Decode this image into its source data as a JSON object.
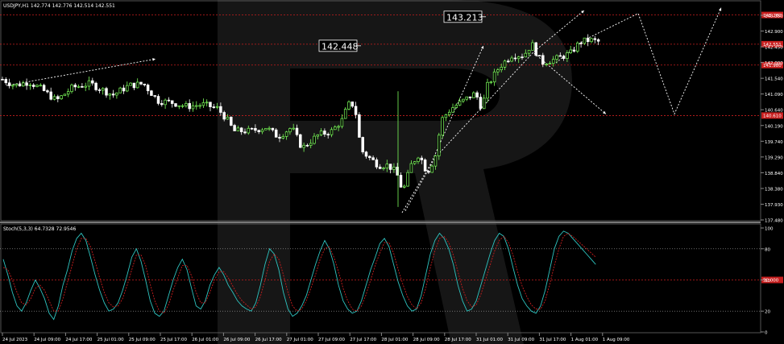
{
  "window": {
    "main_title": "USDJPY,H1  142.774 142.776 142.514 142.551",
    "osc_title": "Stoch(5,3,3) 64.7328 72.9546"
  },
  "colors": {
    "background": "#000000",
    "bull": "#7cfc5a",
    "bear": "#ffffff",
    "level": "#c81e1e",
    "level_tag": "#c81e1e",
    "forecast": "#ffffff",
    "stoch_main": "#2ec4c0",
    "stoch_signal": "#c81e1e",
    "axis_text": "#ffffff",
    "watermark": "#161616"
  },
  "chart_data": [
    {
      "type": "candlestick",
      "symbol": "USDJPY",
      "timeframe": "H1",
      "ylim": [
        137.88,
        143.4
      ],
      "y_ticks": [
        "143.350",
        "142.900",
        "142.450",
        "142.000",
        "141.540",
        "141.090",
        "140.640",
        "140.190",
        "139.740",
        "139.290",
        "138.840",
        "138.380",
        "137.930",
        "137.480"
      ],
      "x_ticks": [
        "24 Jul 2023",
        "24 Jul 09:00",
        "24 Jul 17:00",
        "25 Jul 01:00",
        "25 Jul 09:00",
        "25 Jul 17:00",
        "26 Jul 01:00",
        "26 Jul 09:00",
        "26 Jul 17:00",
        "27 Jul 01:00",
        "27 Jul 09:00",
        "27 Jul 17:00",
        "28 Jul 01:00",
        "28 Jul 09:00",
        "28 Jul 17:00",
        "31 Jul 01:00",
        "31 Jul 09:00",
        "31 Jul 17:00",
        "1 Aug 01:00",
        "1 Aug 09:00"
      ],
      "levels": [
        {
          "value": 143.26,
          "tag": "143.260"
        },
        {
          "value": 142.49,
          "tag": "142.551"
        },
        {
          "value": 141.94,
          "tag": "141.980"
        },
        {
          "value": 140.61,
          "tag": "140.610"
        }
      ],
      "annotations": [
        {
          "text": "143.213",
          "price": 143.213
        },
        {
          "text": "142.448",
          "price": 142.448
        }
      ],
      "waypoints": [
        [
          0,
          141.6
        ],
        [
          18,
          141.4
        ],
        [
          36,
          141.5
        ],
        [
          52,
          141.3
        ],
        [
          70,
          141.0
        ],
        [
          90,
          141.35
        ],
        [
          112,
          141.45
        ],
        [
          140,
          141.15
        ],
        [
          160,
          141.4
        ],
        [
          178,
          141.45
        ],
        [
          196,
          141.0
        ],
        [
          214,
          140.95
        ],
        [
          232,
          140.85
        ],
        [
          252,
          140.9
        ],
        [
          270,
          140.8
        ],
        [
          282,
          140.5
        ],
        [
          290,
          140.2
        ],
        [
          310,
          140.2
        ],
        [
          330,
          140.3
        ],
        [
          345,
          140.05
        ],
        [
          362,
          140.3
        ],
        [
          375,
          139.75
        ],
        [
          395,
          140.1
        ],
        [
          412,
          140.2
        ],
        [
          425,
          140.5
        ],
        [
          432,
          140.9
        ],
        [
          440,
          140.9
        ],
        [
          448,
          139.7
        ],
        [
          458,
          139.5
        ],
        [
          470,
          139.3
        ],
        [
          482,
          139.3
        ],
        [
          492,
          139.1
        ],
        [
          500,
          138.6
        ],
        [
          510,
          139.3
        ],
        [
          520,
          139.6
        ],
        [
          530,
          139.1
        ],
        [
          540,
          139.5
        ],
        [
          548,
          140.5
        ],
        [
          560,
          140.8
        ],
        [
          575,
          141.0
        ],
        [
          590,
          141.2
        ],
        [
          598,
          140.8
        ],
        [
          605,
          141.4
        ],
        [
          620,
          141.9
        ],
        [
          635,
          142.2
        ],
        [
          650,
          142.2
        ],
        [
          660,
          142.5
        ],
        [
          672,
          142.0
        ],
        [
          690,
          142.1
        ],
        [
          708,
          142.25
        ],
        [
          720,
          142.55
        ],
        [
          732,
          142.6
        ],
        [
          744,
          142.55
        ]
      ],
      "forecast_paths": [
        [
          [
            8,
            141.4
          ],
          [
            193,
            142.1
          ]
        ],
        [
          [
            499,
            138.05
          ],
          [
            535,
            139.35
          ],
          [
            600,
            142.45
          ]
        ],
        [
          [
            503,
            138.1
          ],
          [
            540,
            139.5
          ],
          [
            663,
            142.3
          ],
          [
            725,
            143.38
          ]
        ],
        [
          [
            663,
            142.25
          ],
          [
            752,
            140.65
          ]
        ],
        [
          [
            690,
            142.0
          ],
          [
            725,
            142.6
          ],
          [
            792,
            143.3
          ],
          [
            837,
            140.65
          ],
          [
            895,
            143.45
          ]
        ]
      ]
    },
    {
      "type": "line",
      "name": "Stoch(5,3,3)",
      "ylim": [
        0,
        100
      ],
      "y_ticks": [
        "100",
        "80",
        "50",
        "20",
        "0"
      ],
      "levels": [
        {
          "value": 80,
          "style": "dotted"
        },
        {
          "value": 50,
          "tag": "50.000"
        },
        {
          "value": 20,
          "style": "dotted"
        }
      ],
      "series": [
        {
          "role": "main",
          "values_x_step": 6,
          "values": [
            70,
            55,
            38,
            25,
            20,
            28,
            40,
            50,
            42,
            32,
            18,
            12,
            25,
            45,
            60,
            78,
            90,
            95,
            88,
            72,
            55,
            40,
            28,
            20,
            22,
            28,
            40,
            55,
            72,
            80,
            68,
            50,
            30,
            18,
            15,
            20,
            35,
            50,
            62,
            70,
            60,
            42,
            25,
            22,
            30,
            45,
            55,
            62,
            55,
            45,
            38,
            30,
            25,
            22,
            20,
            28,
            45,
            65,
            80,
            75,
            60,
            38,
            22,
            15,
            18,
            25,
            35,
            50,
            65,
            78,
            88,
            80,
            65,
            45,
            30,
            22,
            18,
            20,
            30,
            45,
            60,
            72,
            85,
            90,
            82,
            65,
            48,
            35,
            25,
            20,
            22,
            35,
            55,
            75,
            88,
            95,
            90,
            80,
            65,
            45,
            30,
            20,
            22,
            30,
            45,
            60,
            75,
            88,
            95,
            92,
            80,
            62,
            45,
            32,
            25,
            20,
            18,
            25,
            40,
            60,
            80,
            92,
            97,
            95,
            90,
            85,
            80,
            75,
            70,
            65
          ]
        },
        {
          "role": "signal",
          "values_x_step": 6,
          "values": [
            62,
            60,
            50,
            38,
            28,
            26,
            32,
            42,
            45,
            40,
            30,
            20,
            20,
            32,
            48,
            64,
            80,
            90,
            90,
            82,
            68,
            52,
            38,
            28,
            24,
            25,
            32,
            45,
            60,
            74,
            74,
            64,
            46,
            30,
            20,
            18,
            26,
            40,
            52,
            64,
            64,
            54,
            38,
            28,
            28,
            38,
            50,
            58,
            58,
            52,
            44,
            36,
            30,
            26,
            22,
            24,
            34,
            50,
            68,
            75,
            70,
            55,
            38,
            25,
            20,
            22,
            30,
            42,
            55,
            70,
            80,
            82,
            72,
            58,
            42,
            30,
            22,
            20,
            25,
            36,
            50,
            64,
            76,
            86,
            86,
            76,
            60,
            46,
            34,
            26,
            22,
            28,
            42,
            62,
            78,
            90,
            92,
            86,
            74,
            58,
            42,
            30,
            24,
            26,
            36,
            50,
            64,
            78,
            88,
            92,
            86,
            74,
            58,
            44,
            34,
            26,
            22,
            22,
            30,
            46,
            64,
            80,
            92,
            95,
            92,
            88,
            84,
            80,
            76,
            72
          ]
        }
      ]
    }
  ]
}
